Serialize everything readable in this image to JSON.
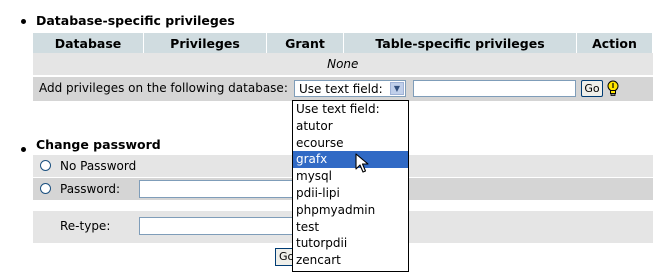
{
  "db_section": {
    "title": "Database-specific privileges",
    "columns": [
      "Database",
      "Privileges",
      "Grant",
      "Table-specific privileges",
      "Action"
    ],
    "empty_text": "None",
    "add_label": "Add privileges on the following database:",
    "select_value": "Use text field:",
    "text_value": "",
    "go_label": "Go",
    "dropdown_options": [
      "Use text field:",
      "atutor",
      "ecourse",
      "grafx",
      "mysql",
      "pdii-lipi",
      "phpmyadmin",
      "test",
      "tutorpdii",
      "zencart"
    ],
    "selected_option": "grafx"
  },
  "password_section": {
    "title": "Change password",
    "no_password_label": "No Password",
    "password_label": "Password:",
    "retype_label": "Re-type:",
    "go_label": "Go"
  },
  "colors": {
    "header_bg": "#d0dce0",
    "row_light": "#e5e5e5",
    "row_dark": "#d5d5d5",
    "selection": "#316ac5"
  },
  "icons": [
    "bulb-icon",
    "dropdown-arrow-icon",
    "cursor-icon",
    "radio-icon"
  ]
}
